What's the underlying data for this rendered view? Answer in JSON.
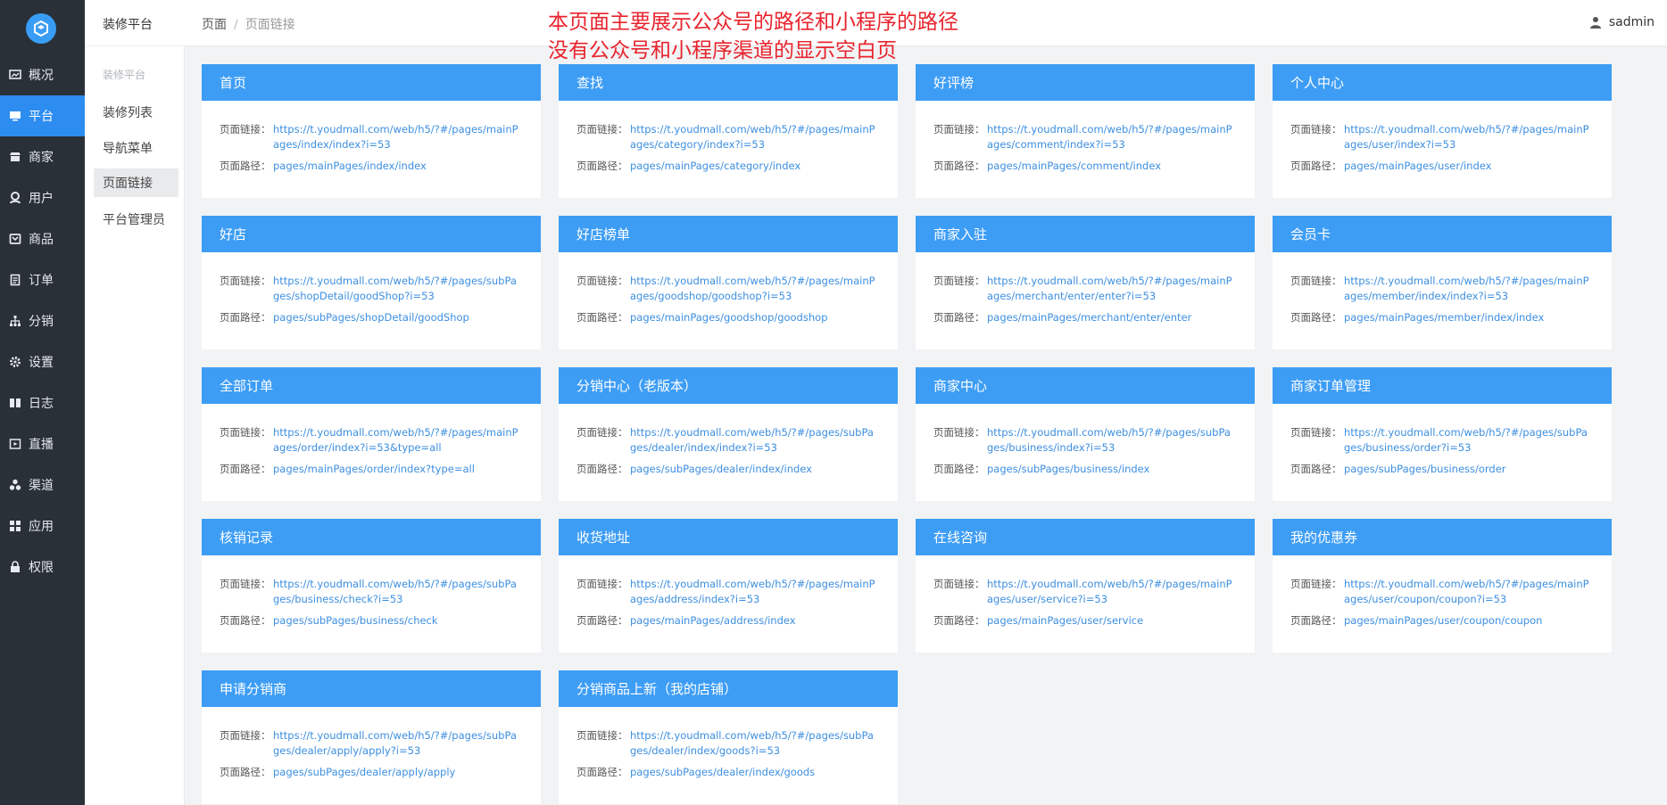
{
  "nav": {
    "items": [
      {
        "label": "概况",
        "icon": "dashboard-icon",
        "active": false
      },
      {
        "label": "平台",
        "icon": "monitor-icon",
        "active": true
      },
      {
        "label": "商家",
        "icon": "store-icon",
        "active": false
      },
      {
        "label": "用户",
        "icon": "user-icon",
        "active": false
      },
      {
        "label": "商品",
        "icon": "goods-icon",
        "active": false
      },
      {
        "label": "订单",
        "icon": "order-icon",
        "active": false
      },
      {
        "label": "分销",
        "icon": "sitemap-icon",
        "active": false
      },
      {
        "label": "设置",
        "icon": "gear-icon",
        "active": false
      },
      {
        "label": "日志",
        "icon": "book-icon",
        "active": false
      },
      {
        "label": "直播",
        "icon": "live-icon",
        "active": false
      },
      {
        "label": "渠道",
        "icon": "channel-icon",
        "active": false
      },
      {
        "label": "应用",
        "icon": "apps-icon",
        "active": false
      },
      {
        "label": "权限",
        "icon": "lock-icon",
        "active": false
      }
    ]
  },
  "submenu": {
    "title": "装修平台",
    "group": "装修平台",
    "items": [
      {
        "label": "装修列表",
        "active": false
      },
      {
        "label": "导航菜单",
        "active": false
      },
      {
        "label": "页面链接",
        "active": true
      },
      {
        "label": "平台管理员",
        "active": false
      }
    ]
  },
  "header": {
    "breadcrumb_root": "页面",
    "breadcrumb_sep": "/",
    "breadcrumb_current": "页面链接",
    "note_line1": "本页面主要展示公众号的路径和小程序的路径",
    "note_line2": "没有公众号和小程序渠道的显示空白页",
    "username": "sadmin"
  },
  "labels": {
    "link": "页面链接：",
    "path": "页面路径："
  },
  "cards": [
    {
      "title": "首页",
      "link": "https://t.youdmall.com/web/h5/?#/pages/mainPages/index/index?i=53",
      "path": "pages/mainPages/index/index"
    },
    {
      "title": "查找",
      "link": "https://t.youdmall.com/web/h5/?#/pages/mainPages/category/index?i=53",
      "path": "pages/mainPages/category/index"
    },
    {
      "title": "好评榜",
      "link": "https://t.youdmall.com/web/h5/?#/pages/mainPages/comment/index?i=53",
      "path": "pages/mainPages/comment/index"
    },
    {
      "title": "个人中心",
      "link": "https://t.youdmall.com/web/h5/?#/pages/mainPages/user/index?i=53",
      "path": "pages/mainPages/user/index"
    },
    {
      "title": "好店",
      "link": "https://t.youdmall.com/web/h5/?#/pages/subPages/shopDetail/goodShop?i=53",
      "path": "pages/subPages/shopDetail/goodShop"
    },
    {
      "title": "好店榜单",
      "link": "https://t.youdmall.com/web/h5/?#/pages/mainPages/goodshop/goodshop?i=53",
      "path": "pages/mainPages/goodshop/goodshop"
    },
    {
      "title": "商家入驻",
      "link": "https://t.youdmall.com/web/h5/?#/pages/mainPages/merchant/enter/enter?i=53",
      "path": "pages/mainPages/merchant/enter/enter"
    },
    {
      "title": "会员卡",
      "link": "https://t.youdmall.com/web/h5/?#/pages/mainPages/member/index/index?i=53",
      "path": "pages/mainPages/member/index/index"
    },
    {
      "title": "全部订单",
      "link": "https://t.youdmall.com/web/h5/?#/pages/mainPages/order/index?i=53&type=all",
      "path": "pages/mainPages/order/index?type=all"
    },
    {
      "title": "分销中心（老版本）",
      "link": "https://t.youdmall.com/web/h5/?#/pages/subPages/dealer/index/index?i=53",
      "path": "pages/subPages/dealer/index/index"
    },
    {
      "title": "商家中心",
      "link": "https://t.youdmall.com/web/h5/?#/pages/subPages/business/index?i=53",
      "path": "pages/subPages/business/index"
    },
    {
      "title": "商家订单管理",
      "link": "https://t.youdmall.com/web/h5/?#/pages/subPages/business/order?i=53",
      "path": "pages/subPages/business/order"
    },
    {
      "title": "核销记录",
      "link": "https://t.youdmall.com/web/h5/?#/pages/subPages/business/check?i=53",
      "path": "pages/subPages/business/check"
    },
    {
      "title": "收货地址",
      "link": "https://t.youdmall.com/web/h5/?#/pages/mainPages/address/index?i=53",
      "path": "pages/mainPages/address/index"
    },
    {
      "title": "在线咨询",
      "link": "https://t.youdmall.com/web/h5/?#/pages/mainPages/user/service?i=53",
      "path": "pages/mainPages/user/service"
    },
    {
      "title": "我的优惠券",
      "link": "https://t.youdmall.com/web/h5/?#/pages/mainPages/user/coupon/coupon?i=53",
      "path": "pages/mainPages/user/coupon/coupon"
    },
    {
      "title": "申请分销商",
      "link": "https://t.youdmall.com/web/h5/?#/pages/subPages/dealer/apply/apply?i=53",
      "path": "pages/subPages/dealer/apply/apply"
    },
    {
      "title": "分销商品上新（我的店铺）",
      "link": "https://t.youdmall.com/web/h5/?#/pages/subPages/dealer/index/goods?i=53",
      "path": "pages/subPages/dealer/index/goods"
    }
  ],
  "colors": {
    "sidebar": "#293038",
    "active": "#2d8cf0",
    "card_head": "#3d9df5",
    "link": "#3d8fe0",
    "note": "#e8242d"
  }
}
